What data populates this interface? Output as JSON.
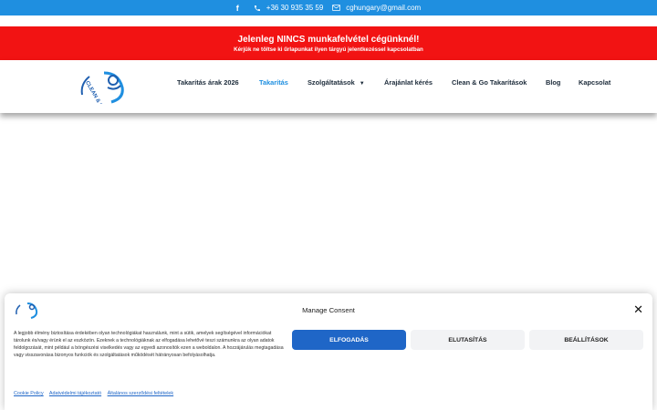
{
  "topbar": {
    "phone": "+36 30 935 35 59",
    "email": "cghungary@gmail.com",
    "icons": [
      "facebook-icon",
      "phone-icon",
      "email-icon"
    ],
    "background": "#1f8fe0"
  },
  "notice": {
    "title": "Jelenleg NINCS munkafelvétel cégünknél!",
    "subtitle": "Kérjük ne töltse ki űrlapunkat ilyen tárgyú jelentkezéssel kapcsolatban",
    "background": "#f21313"
  },
  "header": {
    "logo_text": "CLEAN & GO KFT",
    "nav": [
      {
        "label": "Takarítás árak 2026"
      },
      {
        "label": "Takarítás"
      },
      {
        "label": "Szolgáltatások"
      },
      {
        "label": "Árajánlat kérés"
      },
      {
        "label": "Clean & Go Takarítások"
      },
      {
        "label": "Blog"
      },
      {
        "label": "Kapcsolat"
      }
    ],
    "active_item": "Takarítás",
    "active_color": "#1f8fe0"
  },
  "consent": {
    "title": "Manage Consent",
    "text": "A legjobb élmény biztosítása érdekében olyan technológiákat használunk, mint a sütik, amelyek segítségével információkat tárolunk és/vagy érünk el az eszközön. Ezeknek a technológiáknak az elfogadása lehetővé teszi számunkra az olyan adatok feldolgozását, mint például a böngészési viselkedés vagy az egyedi azonosítók ezen a weboldalon. A hozzájárulás megtagadása vagy visszavonása bizonyos funkciók és szolgáltatások működését hátrányosan befolyásolhatja.",
    "accept_label": "ELFOGADÁS",
    "deny_label": "ELUTASÍTÁS",
    "settings_label": "BEÁLLÍTÁSOK",
    "links": [
      "Cookie Policy",
      "Adatvédelmi tájékoztató",
      "Általános szerződési feltételek"
    ],
    "accept_color": "#1f66c7"
  }
}
